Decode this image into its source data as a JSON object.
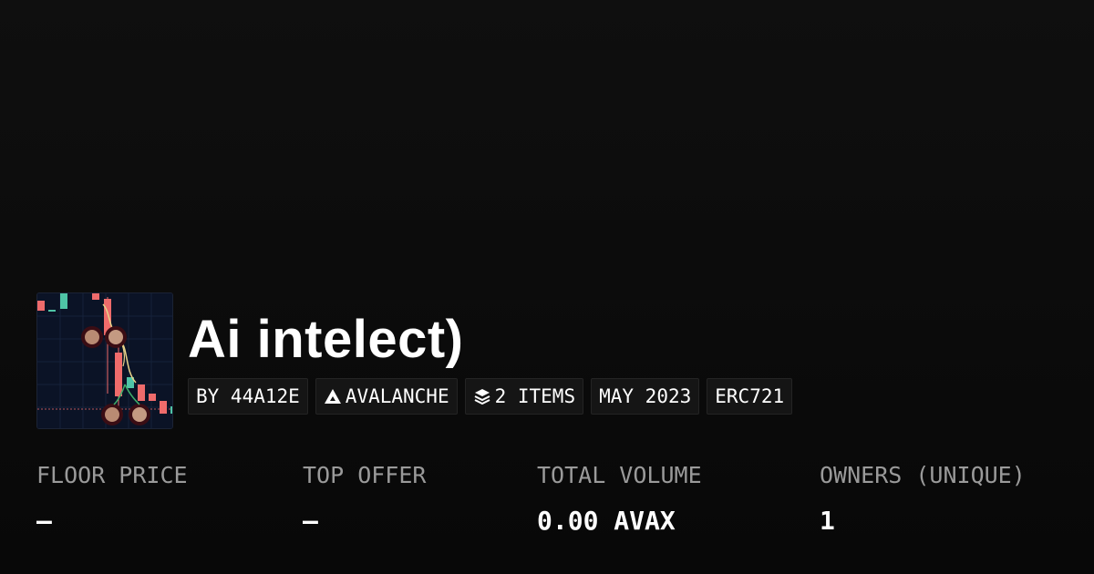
{
  "collection": {
    "title": "Ai intelect)",
    "thumbnail_icon": "candlestick-chart-with-cherries-image"
  },
  "tags": [
    {
      "label": "BY 44A12E",
      "icon": ""
    },
    {
      "label": "AVALANCHE",
      "icon": "avalanche-logo-icon"
    },
    {
      "label": "2 ITEMS",
      "icon": "layers-icon"
    },
    {
      "label": "MAY 2023",
      "icon": ""
    },
    {
      "label": "ERC721",
      "icon": ""
    }
  ],
  "stats": [
    {
      "label": "FLOOR PRICE",
      "value": "–"
    },
    {
      "label": "TOP OFFER",
      "value": "–"
    },
    {
      "label": "TOTAL VOLUME",
      "value": "0.00 AVAX"
    },
    {
      "label": "OWNERS (UNIQUE)",
      "value": "1"
    }
  ],
  "colors": {
    "background": "#0b0b0b",
    "tag_background": "#151515",
    "label_gray": "#9a9a9a",
    "candle_red": "#ef6b6b",
    "candle_green": "#4fc4a6"
  }
}
